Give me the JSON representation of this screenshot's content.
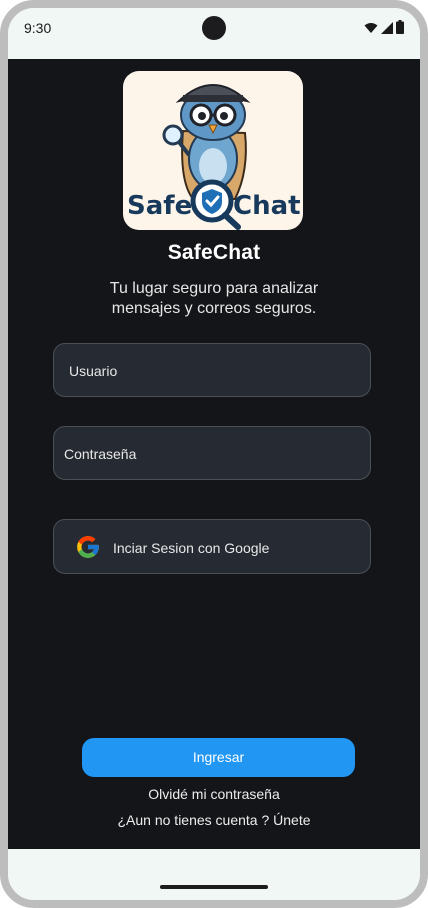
{
  "status_bar": {
    "time": "9:30"
  },
  "logo": {
    "word_left": "Safe",
    "word_right": "Chat"
  },
  "app": {
    "title": "SafeChat",
    "subtitle": "Tu lugar seguro para analizar mensajes y correos seguros."
  },
  "form": {
    "username_placeholder": "Usuario",
    "password_placeholder": "Contraseña",
    "google_label": "Inciar Sesion con Google"
  },
  "actions": {
    "login_label": "Ingresar",
    "forgot_label": "Olvidé mi contraseña",
    "signup_label": "¿Aun no tienes cuenta ? Únete"
  },
  "colors": {
    "background": "#141519",
    "field": "#262a32",
    "primary": "#2196f3",
    "logo_blue": "#1e6fb5"
  },
  "icons": [
    "wifi-icon",
    "signal-icon",
    "battery-icon",
    "google-icon",
    "owl-detective-logo",
    "shield-check-icon"
  ]
}
